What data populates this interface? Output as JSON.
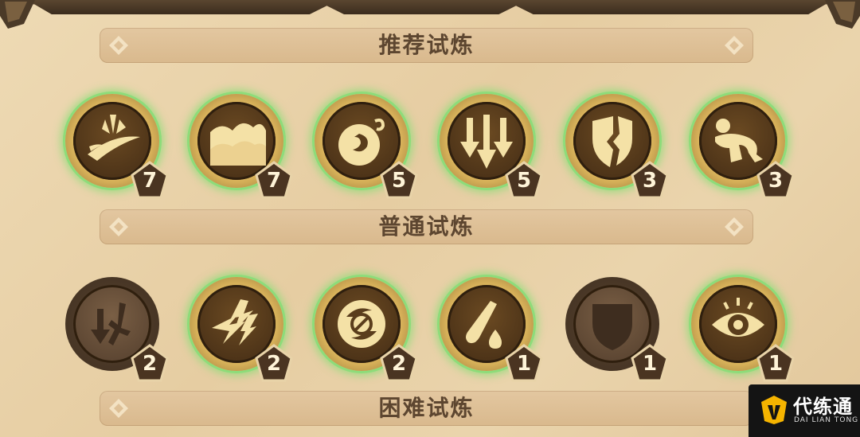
{
  "sections": [
    {
      "title": "推荐试炼",
      "badges": [
        {
          "icon": "slash-strike-icon",
          "level": "7",
          "state": "active"
        },
        {
          "icon": "cloud-wing-icon",
          "level": "7",
          "state": "active"
        },
        {
          "icon": "swirl-orb-icon",
          "level": "5",
          "state": "active"
        },
        {
          "icon": "triple-arrow-icon",
          "level": "5",
          "state": "active"
        },
        {
          "icon": "broken-shield-icon",
          "level": "3",
          "state": "active"
        },
        {
          "icon": "crouching-figure-icon",
          "level": "3",
          "state": "active"
        }
      ]
    },
    {
      "title": "普通试炼",
      "badges": [
        {
          "icon": "arrow-sword-icon",
          "level": "2",
          "state": "locked"
        },
        {
          "icon": "lightning-arrow-icon",
          "level": "2",
          "state": "active"
        },
        {
          "icon": "swirl-block-icon",
          "level": "2",
          "state": "active"
        },
        {
          "icon": "potion-drop-icon",
          "level": "1",
          "state": "active"
        },
        {
          "icon": "shield-icon",
          "level": "1",
          "state": "locked"
        },
        {
          "icon": "eye-icon",
          "level": "1",
          "state": "active"
        }
      ]
    },
    {
      "title": "困难试炼"
    }
  ],
  "watermark": {
    "name": "代练通",
    "sub": "DAI LIAN TONG"
  }
}
